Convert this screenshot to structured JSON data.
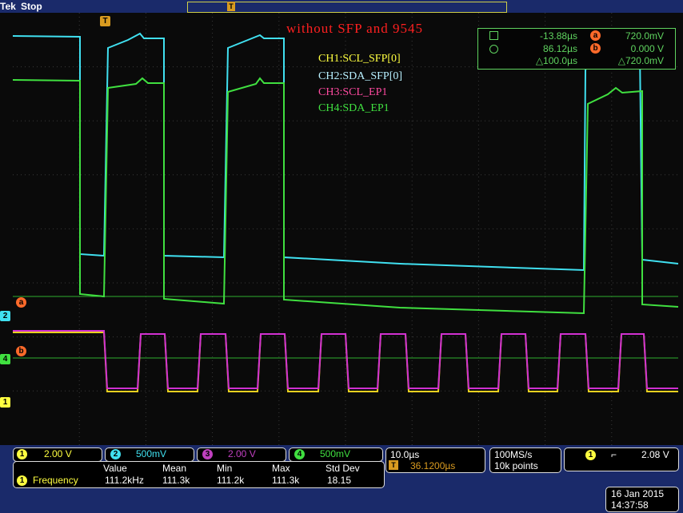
{
  "header": {
    "brand": "Tek",
    "status": "Stop"
  },
  "screen": {
    "title": "without SFP and 9545",
    "legend": [
      {
        "label": "CH1:SCL_SFP[0]",
        "color": "#ffff40"
      },
      {
        "label": "CH2:SDA_SFP[0]",
        "color": "#b8f0ff"
      },
      {
        "label": "CH3:SCL_EP1",
        "color": "#ff4aa0"
      },
      {
        "label": "CH4:SDA_EP1",
        "color": "#40e040"
      }
    ],
    "cursor_readout": {
      "t_a": "-13.88µs",
      "v_a": "720.0mV",
      "t_b": "86.12µs",
      "v_b": "0.000 V",
      "dt": "△100.0µs",
      "dv": "△720.0mV",
      "a_label": "a",
      "b_label": "b"
    },
    "markers": {
      "trigger": "T",
      "ch2": "2",
      "ch4": "4",
      "ch1": "1",
      "cursor_a": "a",
      "cursor_b": "b"
    }
  },
  "channels": [
    {
      "num": "1",
      "scale": "2.00 V",
      "color": "#ffff40"
    },
    {
      "num": "2",
      "scale": "500mV",
      "color": "#40e0f0"
    },
    {
      "num": "3",
      "scale": "2.00 V",
      "color": "#c040c0"
    },
    {
      "num": "4",
      "scale": "500mV",
      "color": "#40e040"
    }
  ],
  "timebase": {
    "scale": "10.0µs",
    "trigger_pos": "36.1200µs",
    "sample_rate": "100MS/s",
    "record_length": "10k points"
  },
  "trigger": {
    "channel": "1",
    "slope": "⌐",
    "level": "2.08 V"
  },
  "measurement": {
    "headers": [
      "Value",
      "Mean",
      "Min",
      "Max",
      "Std Dev"
    ],
    "channel": "1",
    "name": "Frequency",
    "values": [
      "111.2kHz",
      "111.3k",
      "111.2k",
      "111.3k",
      "18.15"
    ]
  },
  "datetime": {
    "date": "16 Jan  2015",
    "time": "14:37:58"
  }
}
